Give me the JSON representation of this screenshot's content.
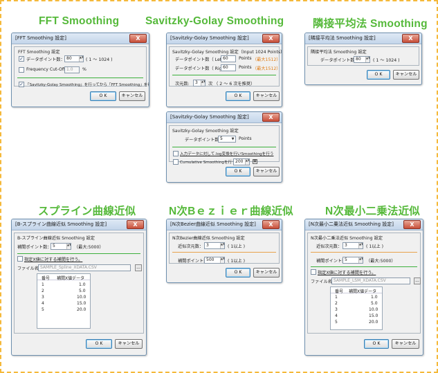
{
  "headings": {
    "fft": "FFT Smoothing",
    "sg": "Savitzky-Golay Smoothing",
    "ma": "隣接平均法 Smoothing",
    "spline": "スプライン曲線近似",
    "bezier": "N次Bｅｚｉｅｒ曲線近似",
    "lsm": "N次最小二乗法近似"
  },
  "common": {
    "ok": "O K",
    "cancel": "キャンセル",
    "close": "X",
    "checked": "✓",
    "browse": "..."
  },
  "fft": {
    "title": "[FFT Smoothing 設定]",
    "group": "FFT Smoothing 設定",
    "points_label": "データポイント数：",
    "points_value": "80",
    "points_range": "( 1 〜 1024 )",
    "cutoff_label": "Frequency Cut-Off:",
    "cutoff_value": "1.0",
    "cutoff_unit": "%",
    "sg_first_label": "「Savitzky-Golay Smoothing」を行ってから「FFT Smoothing」を行う"
  },
  "sg": {
    "title": "[Savitzky-Golay Smoothing 設定]",
    "group": "Savitzky-Golay Smoothing 設定（Input 1024 Points）",
    "left_label": "データポイント数（ Left ）:",
    "left_value": "60",
    "right_label": "データポイント数（ Right ）:",
    "right_value": "60",
    "points_unit": "Points",
    "max_note": "（最大1512）",
    "order_label": "次元数:",
    "order_value": "3",
    "order_range": "次 （ 2 〜 6 次を推奨）"
  },
  "sg2": {
    "title": "[Savitzky-Golay Smoothing 設定]",
    "group": "Savitzky-Golay Smoothing 設定",
    "points_label": "データポイント数：",
    "points_value": "5",
    "points_unit": "Points",
    "log_label": "入力データに対して.log変換を行いSmoothingを行う",
    "cumulative_label": "Cumulative Smoothingを行う",
    "cumulative_value": "200"
  },
  "ma": {
    "title": "[隣接平均法 Smoothing 設定]",
    "group": "隣接平均法 Smoothing 設定",
    "points_label": "データポイント数：",
    "points_value": "80",
    "points_range": "( 1 〜 1024 )"
  },
  "spline": {
    "title": "[B-スプライン曲線近似 Smoothing 設定]",
    "group": "B-スプライン曲線近似 Smoothing 設定",
    "points_label": "補間ポイント数：",
    "points_value": "5",
    "points_max": "（最大:5000）",
    "fixed_label": "指定X値に対する補間を行う。",
    "file_label": "ファイル名:",
    "file_value": "SAMPLE_Spline_XDATA.CSV",
    "col_no": "番号",
    "col_data": "補間X値データ",
    "rows": [
      [
        "1",
        "1.0"
      ],
      [
        "2",
        "5.0"
      ],
      [
        "3",
        "10.0"
      ],
      [
        "4",
        "15.0"
      ],
      [
        "5",
        "20.0"
      ]
    ]
  },
  "bezier": {
    "title": "[N次Bezier曲線近似 Smoothing 設定]",
    "group": "N次Bezier曲線近似 Smoothing 設定",
    "order_label": "近似次元数：",
    "order_value": "3",
    "order_note": "( 1以上 )",
    "points_label": "補間ポイント数：",
    "points_value": "500",
    "points_note": "( 1以上 )"
  },
  "lsm": {
    "title": "[N次最小二乗法近似 Smoothing 設定]",
    "group": "N次最小二乗法近似 Smoothing 設定",
    "order_label": "近似次元数：",
    "order_value": "3",
    "order_note": "( 1以上 )",
    "points_label": "補間ポイント数：",
    "points_value": "5",
    "points_max": "（最大:5000）",
    "fixed_label": "指定X値に対する補間を行う。",
    "file_label": "ファイル名:",
    "file_value": "SAMPLE_LSM_XDATA.CSV",
    "col_no": "番号",
    "col_data": "補間X値データ",
    "rows": [
      [
        "1",
        "1.0"
      ],
      [
        "2",
        "5.0"
      ],
      [
        "3",
        "10.0"
      ],
      [
        "4",
        "15.0"
      ],
      [
        "5",
        "20.0"
      ]
    ]
  }
}
